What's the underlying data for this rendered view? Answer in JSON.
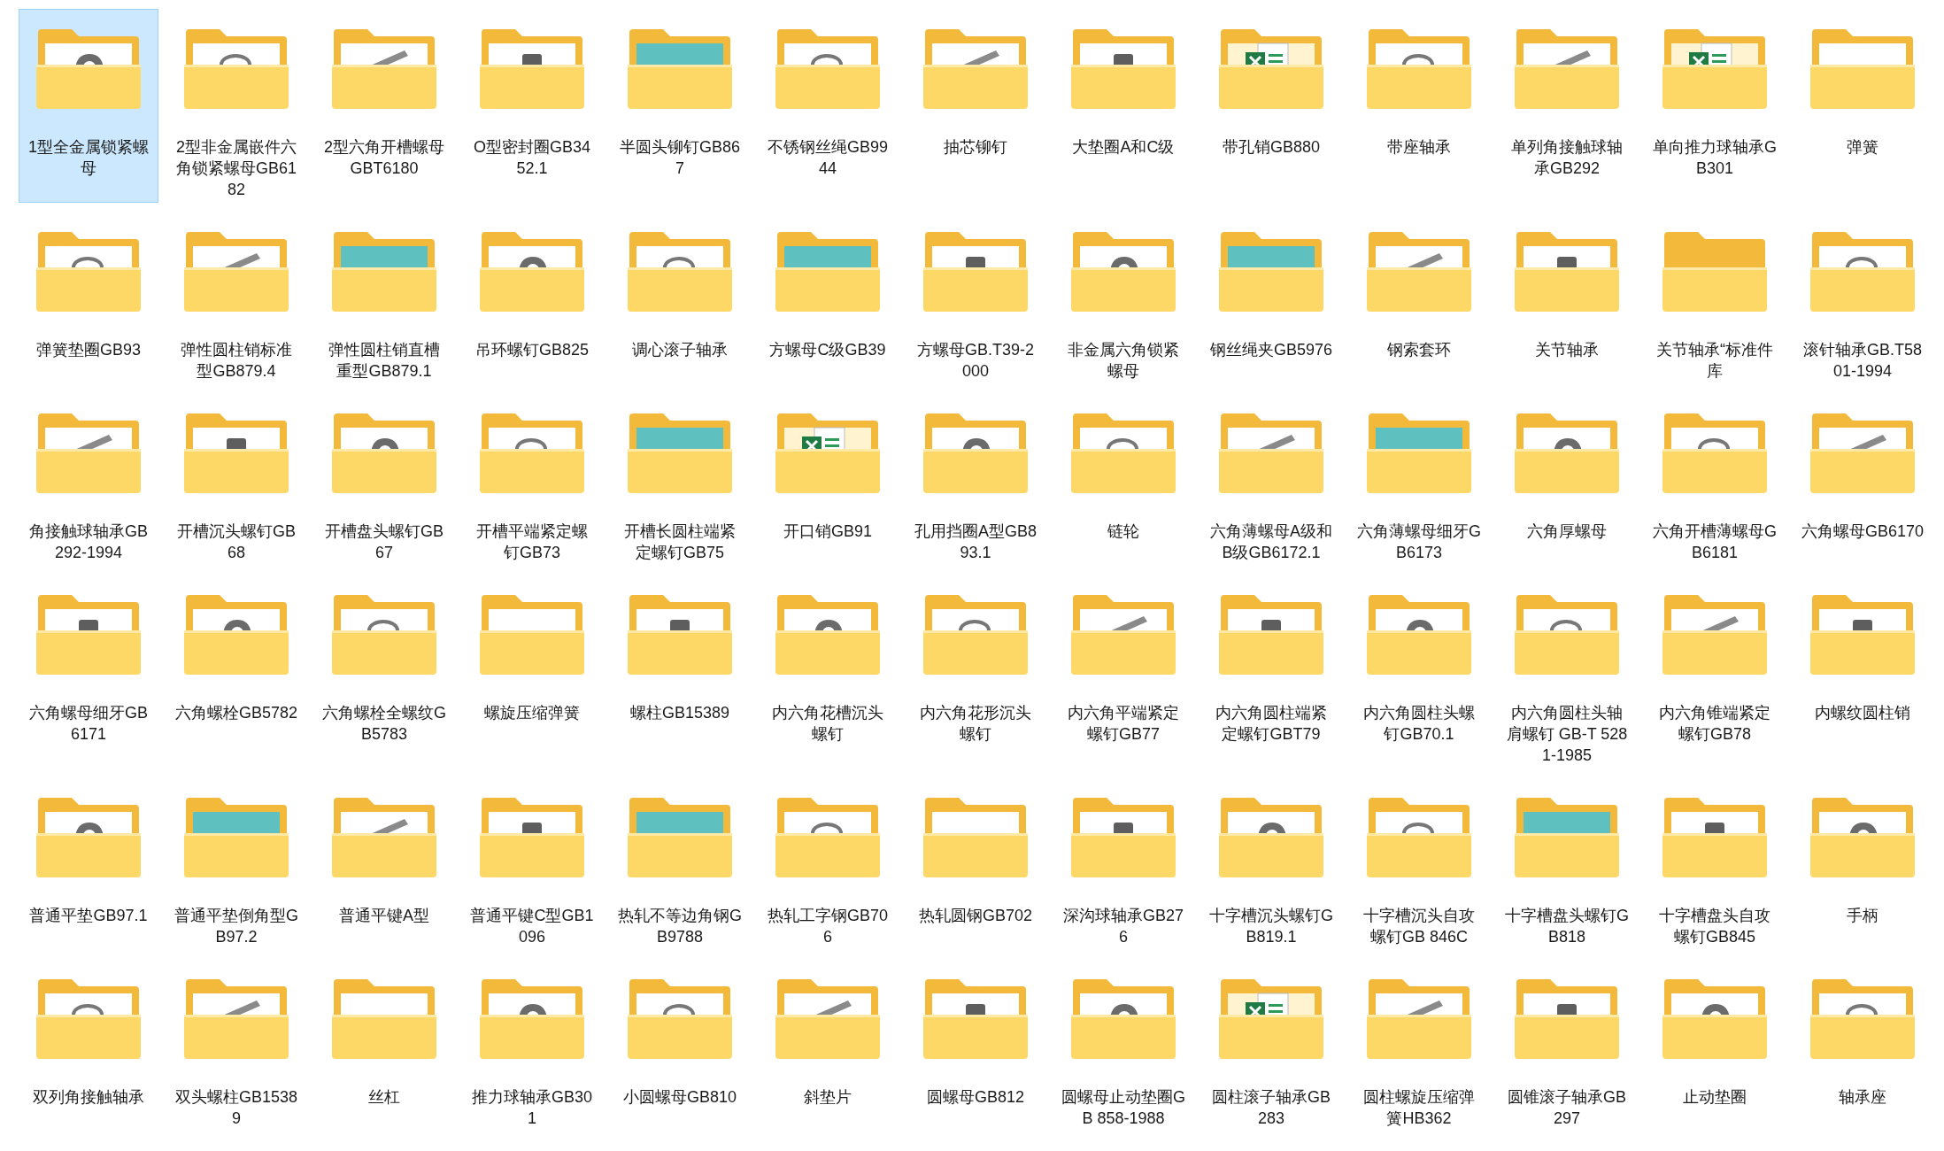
{
  "items": [
    {
      "label": "1型全金属锁紧螺母",
      "selected": true,
      "kind": "part"
    },
    {
      "label": "2型非金属嵌件六角锁紧螺母GB6182",
      "selected": false,
      "kind": "part"
    },
    {
      "label": "2型六角开槽螺母GBT6180",
      "selected": false,
      "kind": "part"
    },
    {
      "label": "O型密封圈GB3452.1",
      "selected": false,
      "kind": "part"
    },
    {
      "label": "半圆头铆钉GB867",
      "selected": false,
      "kind": "teal"
    },
    {
      "label": "不锈钢丝绳GB9944",
      "selected": false,
      "kind": "part"
    },
    {
      "label": "抽芯铆钉",
      "selected": false,
      "kind": "part"
    },
    {
      "label": "大垫圈A和C级",
      "selected": false,
      "kind": "part"
    },
    {
      "label": "带孔销GB880",
      "selected": false,
      "kind": "excel"
    },
    {
      "label": "带座轴承",
      "selected": false,
      "kind": "part"
    },
    {
      "label": "单列角接触球轴承GB292",
      "selected": false,
      "kind": "part"
    },
    {
      "label": "单向推力球轴承GB301",
      "selected": false,
      "kind": "excel"
    },
    {
      "label": "弹簧",
      "selected": false,
      "kind": "empty"
    },
    {
      "label": "弹簧垫圈GB93",
      "selected": false,
      "kind": "part"
    },
    {
      "label": "弹性圆柱销标准型GB879.4",
      "selected": false,
      "kind": "part"
    },
    {
      "label": "弹性圆柱销直槽重型GB879.1",
      "selected": false,
      "kind": "teal"
    },
    {
      "label": "吊环螺钉GB825",
      "selected": false,
      "kind": "part"
    },
    {
      "label": "调心滚子轴承",
      "selected": false,
      "kind": "part"
    },
    {
      "label": "方螺母C级GB39",
      "selected": false,
      "kind": "teal"
    },
    {
      "label": "方螺母GB.T39-2000",
      "selected": false,
      "kind": "part"
    },
    {
      "label": "非金属六角锁紧螺母",
      "selected": false,
      "kind": "part"
    },
    {
      "label": "钢丝绳夹GB5976",
      "selected": false,
      "kind": "teal"
    },
    {
      "label": "钢索套环",
      "selected": false,
      "kind": "part"
    },
    {
      "label": "关节轴承",
      "selected": false,
      "kind": "part"
    },
    {
      "label": "关节轴承“标准件库",
      "selected": false,
      "kind": "none"
    },
    {
      "label": "滚针轴承GB.T5801-1994",
      "selected": false,
      "kind": "part"
    },
    {
      "label": "角接触球轴承GB292-1994",
      "selected": false,
      "kind": "part"
    },
    {
      "label": "开槽沉头螺钉GB68",
      "selected": false,
      "kind": "part"
    },
    {
      "label": "开槽盘头螺钉GB67",
      "selected": false,
      "kind": "part"
    },
    {
      "label": "开槽平端紧定螺钉GB73",
      "selected": false,
      "kind": "part"
    },
    {
      "label": "开槽长圆柱端紧定螺钉GB75",
      "selected": false,
      "kind": "teal"
    },
    {
      "label": "开口销GB91",
      "selected": false,
      "kind": "excel"
    },
    {
      "label": "孔用挡圈A型GB893.1",
      "selected": false,
      "kind": "part"
    },
    {
      "label": "链轮",
      "selected": false,
      "kind": "part"
    },
    {
      "label": "六角薄螺母A级和B级GB6172.1",
      "selected": false,
      "kind": "part"
    },
    {
      "label": "六角薄螺母细牙GB6173",
      "selected": false,
      "kind": "teal"
    },
    {
      "label": "六角厚螺母",
      "selected": false,
      "kind": "part"
    },
    {
      "label": "六角开槽薄螺母GB6181",
      "selected": false,
      "kind": "part"
    },
    {
      "label": "六角螺母GB6170",
      "selected": false,
      "kind": "part"
    },
    {
      "label": "六角螺母细牙GB6171",
      "selected": false,
      "kind": "part"
    },
    {
      "label": "六角螺栓GB5782",
      "selected": false,
      "kind": "part"
    },
    {
      "label": "六角螺栓全螺纹GB5783",
      "selected": false,
      "kind": "part"
    },
    {
      "label": "螺旋压缩弹簧",
      "selected": false,
      "kind": "empty"
    },
    {
      "label": "螺柱GB15389",
      "selected": false,
      "kind": "part"
    },
    {
      "label": "内六角花槽沉头螺钉",
      "selected": false,
      "kind": "part"
    },
    {
      "label": "内六角花形沉头螺钉",
      "selected": false,
      "kind": "part"
    },
    {
      "label": "内六角平端紧定螺钉GB77",
      "selected": false,
      "kind": "part"
    },
    {
      "label": "内六角圆柱端紧定螺钉GBT79",
      "selected": false,
      "kind": "part"
    },
    {
      "label": "内六角圆柱头螺钉GB70.1",
      "selected": false,
      "kind": "part"
    },
    {
      "label": "内六角圆柱头轴肩螺钉 GB-T 5281-1985",
      "selected": false,
      "kind": "part"
    },
    {
      "label": "内六角锥端紧定螺钉GB78",
      "selected": false,
      "kind": "part"
    },
    {
      "label": "内螺纹圆柱销",
      "selected": false,
      "kind": "part"
    },
    {
      "label": "普通平垫GB97.1",
      "selected": false,
      "kind": "part"
    },
    {
      "label": "普通平垫倒角型GB97.2",
      "selected": false,
      "kind": "teal"
    },
    {
      "label": "普通平键A型",
      "selected": false,
      "kind": "part"
    },
    {
      "label": "普通平键C型GB1096",
      "selected": false,
      "kind": "part"
    },
    {
      "label": "热轧不等边角钢GB9788",
      "selected": false,
      "kind": "teal"
    },
    {
      "label": "热轧工字钢GB706",
      "selected": false,
      "kind": "part"
    },
    {
      "label": "热轧圆钢GB702",
      "selected": false,
      "kind": "empty"
    },
    {
      "label": "深沟球轴承GB276",
      "selected": false,
      "kind": "part"
    },
    {
      "label": "十字槽沉头螺钉GB819.1",
      "selected": false,
      "kind": "part"
    },
    {
      "label": "十字槽沉头自攻螺钉GB 846C",
      "selected": false,
      "kind": "part"
    },
    {
      "label": "十字槽盘头螺钉GB818",
      "selected": false,
      "kind": "teal"
    },
    {
      "label": "十字槽盘头自攻螺钉GB845",
      "selected": false,
      "kind": "part"
    },
    {
      "label": "手柄",
      "selected": false,
      "kind": "part"
    },
    {
      "label": "双列角接触轴承",
      "selected": false,
      "kind": "part"
    },
    {
      "label": "双头螺柱GB15389",
      "selected": false,
      "kind": "part"
    },
    {
      "label": "丝杠",
      "selected": false,
      "kind": "empty"
    },
    {
      "label": "推力球轴承GB301",
      "selected": false,
      "kind": "part"
    },
    {
      "label": "小圆螺母GB810",
      "selected": false,
      "kind": "part"
    },
    {
      "label": "斜垫片",
      "selected": false,
      "kind": "part"
    },
    {
      "label": "圆螺母GB812",
      "selected": false,
      "kind": "part"
    },
    {
      "label": "圆螺母止动垫圈GB 858-1988",
      "selected": false,
      "kind": "part"
    },
    {
      "label": "圆柱滚子轴承GB283",
      "selected": false,
      "kind": "excel"
    },
    {
      "label": "圆柱螺旋压缩弹簧HB362",
      "selected": false,
      "kind": "part"
    },
    {
      "label": "圆锥滚子轴承GB297",
      "selected": false,
      "kind": "part"
    },
    {
      "label": "止动垫圈",
      "selected": false,
      "kind": "part"
    },
    {
      "label": "轴承座",
      "selected": false,
      "kind": "part"
    }
  ]
}
